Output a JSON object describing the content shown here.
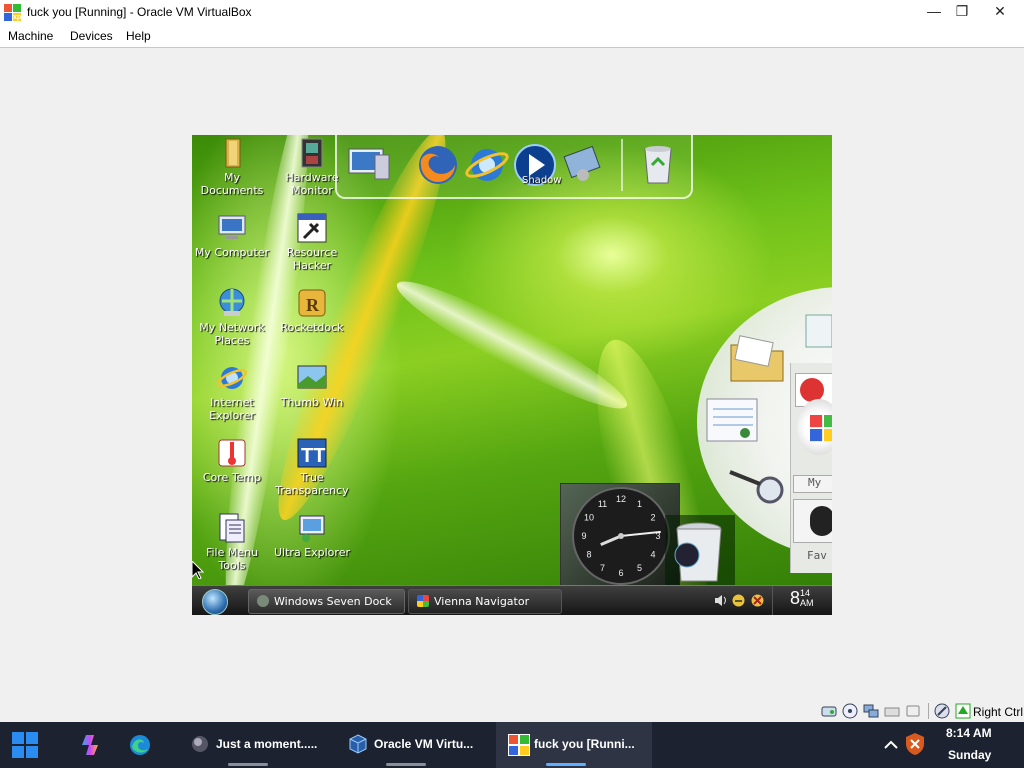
{
  "window": {
    "title": "fuck you [Running] - Oracle VM VirtualBox",
    "minimize": "—",
    "restore": "❐",
    "close": "✕"
  },
  "menu": [
    "Machine",
    "Devices",
    "Help"
  ],
  "desktop_icons": [
    {
      "label": "My Documents",
      "icon": "folder-icon"
    },
    {
      "label": "Hardware Monitor",
      "icon": "chip-icon"
    },
    {
      "label": "My Computer",
      "icon": "computer-icon"
    },
    {
      "label": "Resource Hacker",
      "icon": "tool-icon"
    },
    {
      "label": "My Network Places",
      "icon": "network-icon"
    },
    {
      "label": "Rocketdock",
      "icon": "rocketdock-icon"
    },
    {
      "label": "Internet Explorer",
      "icon": "ie-icon"
    },
    {
      "label": "Thumb Win",
      "icon": "thumbnail-icon"
    },
    {
      "label": "Core Temp",
      "icon": "thermometer-icon"
    },
    {
      "label": "True Transparency",
      "icon": "tt-icon"
    },
    {
      "label": "File Menu Tools",
      "icon": "document-icon"
    },
    {
      "label": "Ultra Explorer",
      "icon": "explorer-icon"
    }
  ],
  "dock": {
    "label": "Shadow",
    "icons": [
      "computer-icon",
      "firefox-icon",
      "ie-icon",
      "media-player-icon",
      "settings-icon",
      "recycle-bin-icon"
    ]
  },
  "navigator": {
    "label": "My",
    "label2": "Fav"
  },
  "clock_gadget": {
    "numbers": [
      "12",
      "1",
      "2",
      "3",
      "4",
      "5",
      "6",
      "7",
      "8",
      "9",
      "10",
      "11"
    ],
    "hour": 8,
    "minute": 14
  },
  "vm_taskbar": {
    "tasks": [
      "Windows Seven Dock",
      "Vienna Navigator"
    ],
    "time_hour": "8",
    "time_min": "14",
    "time_ampm": "AM"
  },
  "vb_status": {
    "host_key": "Right Ctrl"
  },
  "host_taskbar": {
    "apps": [
      {
        "label": "Just a moment.....",
        "icon": "app-icon",
        "active": false
      },
      {
        "label": "Oracle VM Virtu...",
        "icon": "virtualbox-icon",
        "active": false
      },
      {
        "label": "fuck you [Runni...",
        "icon": "vm-window-icon",
        "active": true
      }
    ],
    "time": "8:14 AM",
    "day": "Sunday"
  }
}
